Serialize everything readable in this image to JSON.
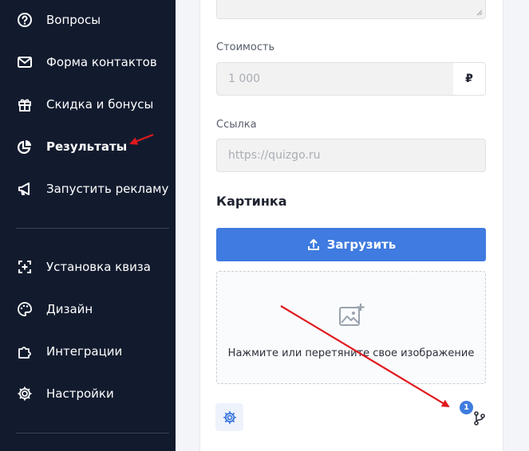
{
  "sidebar": {
    "items": [
      {
        "label": "Вопросы",
        "icon": "question-circle-icon"
      },
      {
        "label": "Форма контактов",
        "icon": "mail-icon"
      },
      {
        "label": "Скидка и бонусы",
        "icon": "gift-icon"
      },
      {
        "label": "Результаты",
        "icon": "pie-chart-icon",
        "active": true
      },
      {
        "label": "Запустить рекламу",
        "icon": "megaphone-icon"
      },
      {
        "label": "Установка квиза",
        "icon": "install-icon"
      },
      {
        "label": "Дизайн",
        "icon": "palette-icon"
      },
      {
        "label": "Интеграции",
        "icon": "puzzle-icon"
      },
      {
        "label": "Настройки",
        "icon": "gear-icon"
      }
    ]
  },
  "form": {
    "price_label": "Стоимость",
    "price_placeholder": "1 000",
    "currency": "₽",
    "link_label": "Ссылка",
    "link_placeholder": "https://quizgo.ru",
    "image_title": "Картинка",
    "upload_label": "Загрузить",
    "dropzone_text": "Нажмите или перетяните свое изображение",
    "branch_badge": "1"
  },
  "colors": {
    "sidebar_bg": "#121b2e",
    "accent": "#3f7be0",
    "annotation_arrow": "#e0191e"
  }
}
